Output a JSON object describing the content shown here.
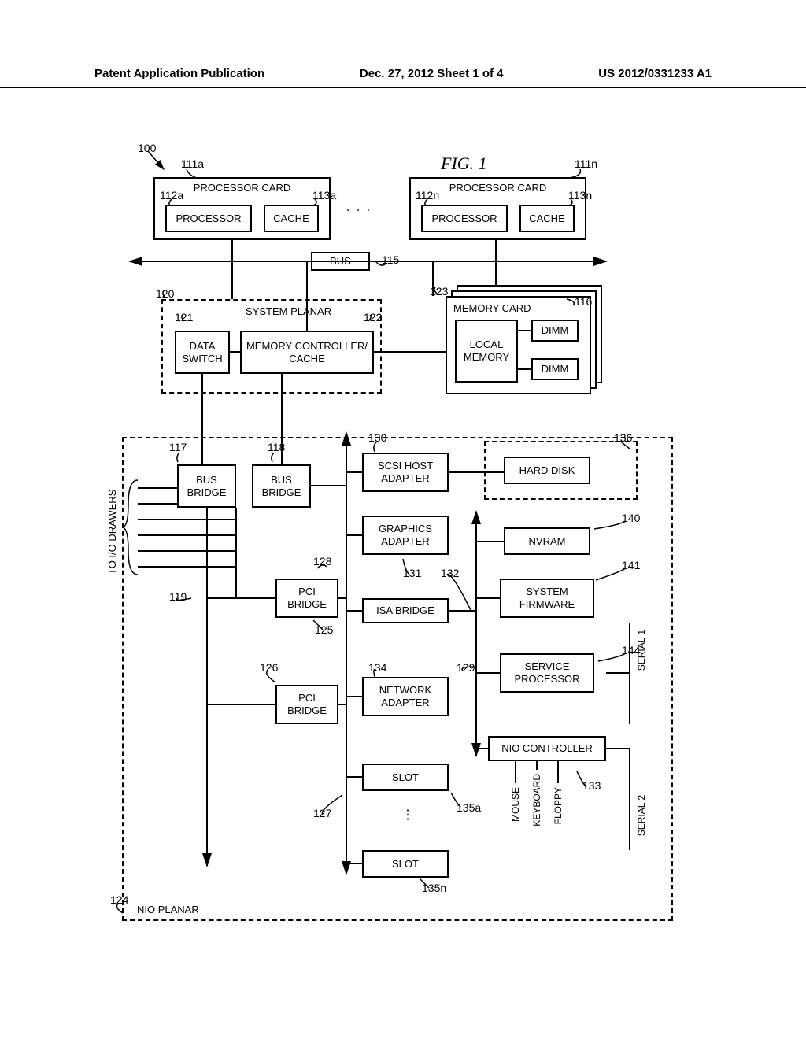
{
  "header": {
    "left": "Patent Application Publication",
    "center": "Dec. 27, 2012  Sheet 1 of 4",
    "right": "US 2012/0331233 A1"
  },
  "figure": {
    "title": "FIG. 1"
  },
  "refs": {
    "r100": "100",
    "r111a": "111a",
    "r111n": "111n",
    "r112a": "112a",
    "r112n": "112n",
    "r113a": "113a",
    "r113n": "113n",
    "r115": "115",
    "r116": "116",
    "r117": "117",
    "r118": "118",
    "r119": "119",
    "r120": "120",
    "r121": "121",
    "r122": "122",
    "r123": "123",
    "r124": "124",
    "r125": "125",
    "r126": "126",
    "r127": "127",
    "r128": "128",
    "r129": "129",
    "r130": "130",
    "r131": "131",
    "r132": "132",
    "r133": "133",
    "r134": "134",
    "r135a": "135a",
    "r135n": "135n",
    "r136": "136",
    "r140": "140",
    "r141": "141",
    "r144": "144"
  },
  "blocks": {
    "proc_card_a": "PROCESSOR CARD",
    "proc_card_n": "PROCESSOR CARD",
    "processor_a": "PROCESSOR",
    "processor_n": "PROCESSOR",
    "cache_a": "CACHE",
    "cache_n": "CACHE",
    "bus": "BUS",
    "system_planar": "SYSTEM PLANAR",
    "data_switch": "DATA\nSWITCH",
    "mem_ctrl": "MEMORY CONTROLLER/\nCACHE",
    "memory_card": "MEMORY CARD",
    "local_memory": "LOCAL\nMEMORY",
    "dimm1": "DIMM",
    "dimm2": "DIMM",
    "bus_bridge1": "BUS\nBRIDGE",
    "bus_bridge2": "BUS\nBRIDGE",
    "scsi_host": "SCSI HOST\nADAPTER",
    "hard_disk": "HARD DISK",
    "graphics": "GRAPHICS\nADAPTER",
    "nvram": "NVRAM",
    "pci_bridge1": "PCI\nBRIDGE",
    "pci_bridge2": "PCI\nBRIDGE",
    "isa_bridge": "ISA BRIDGE",
    "system_firmware": "SYSTEM\nFIRMWARE",
    "service_proc": "SERVICE\nPROCESSOR",
    "network_adapter": "NETWORK\nADAPTER",
    "nio_controller": "NIO CONTROLLER",
    "slot_a": "SLOT",
    "slot_n": "SLOT",
    "nio_planar": "NIO PLANAR",
    "io_drawers": "TO I/O DRAWERS",
    "mouse": "MOUSE",
    "keyboard": "KEYBOARD",
    "floppy": "FLOPPY",
    "serial1": "SERIAL 1",
    "serial2": "SERIAL 2"
  },
  "misc": {
    "ellipsis": ". . .",
    "vdots": "⋮"
  }
}
